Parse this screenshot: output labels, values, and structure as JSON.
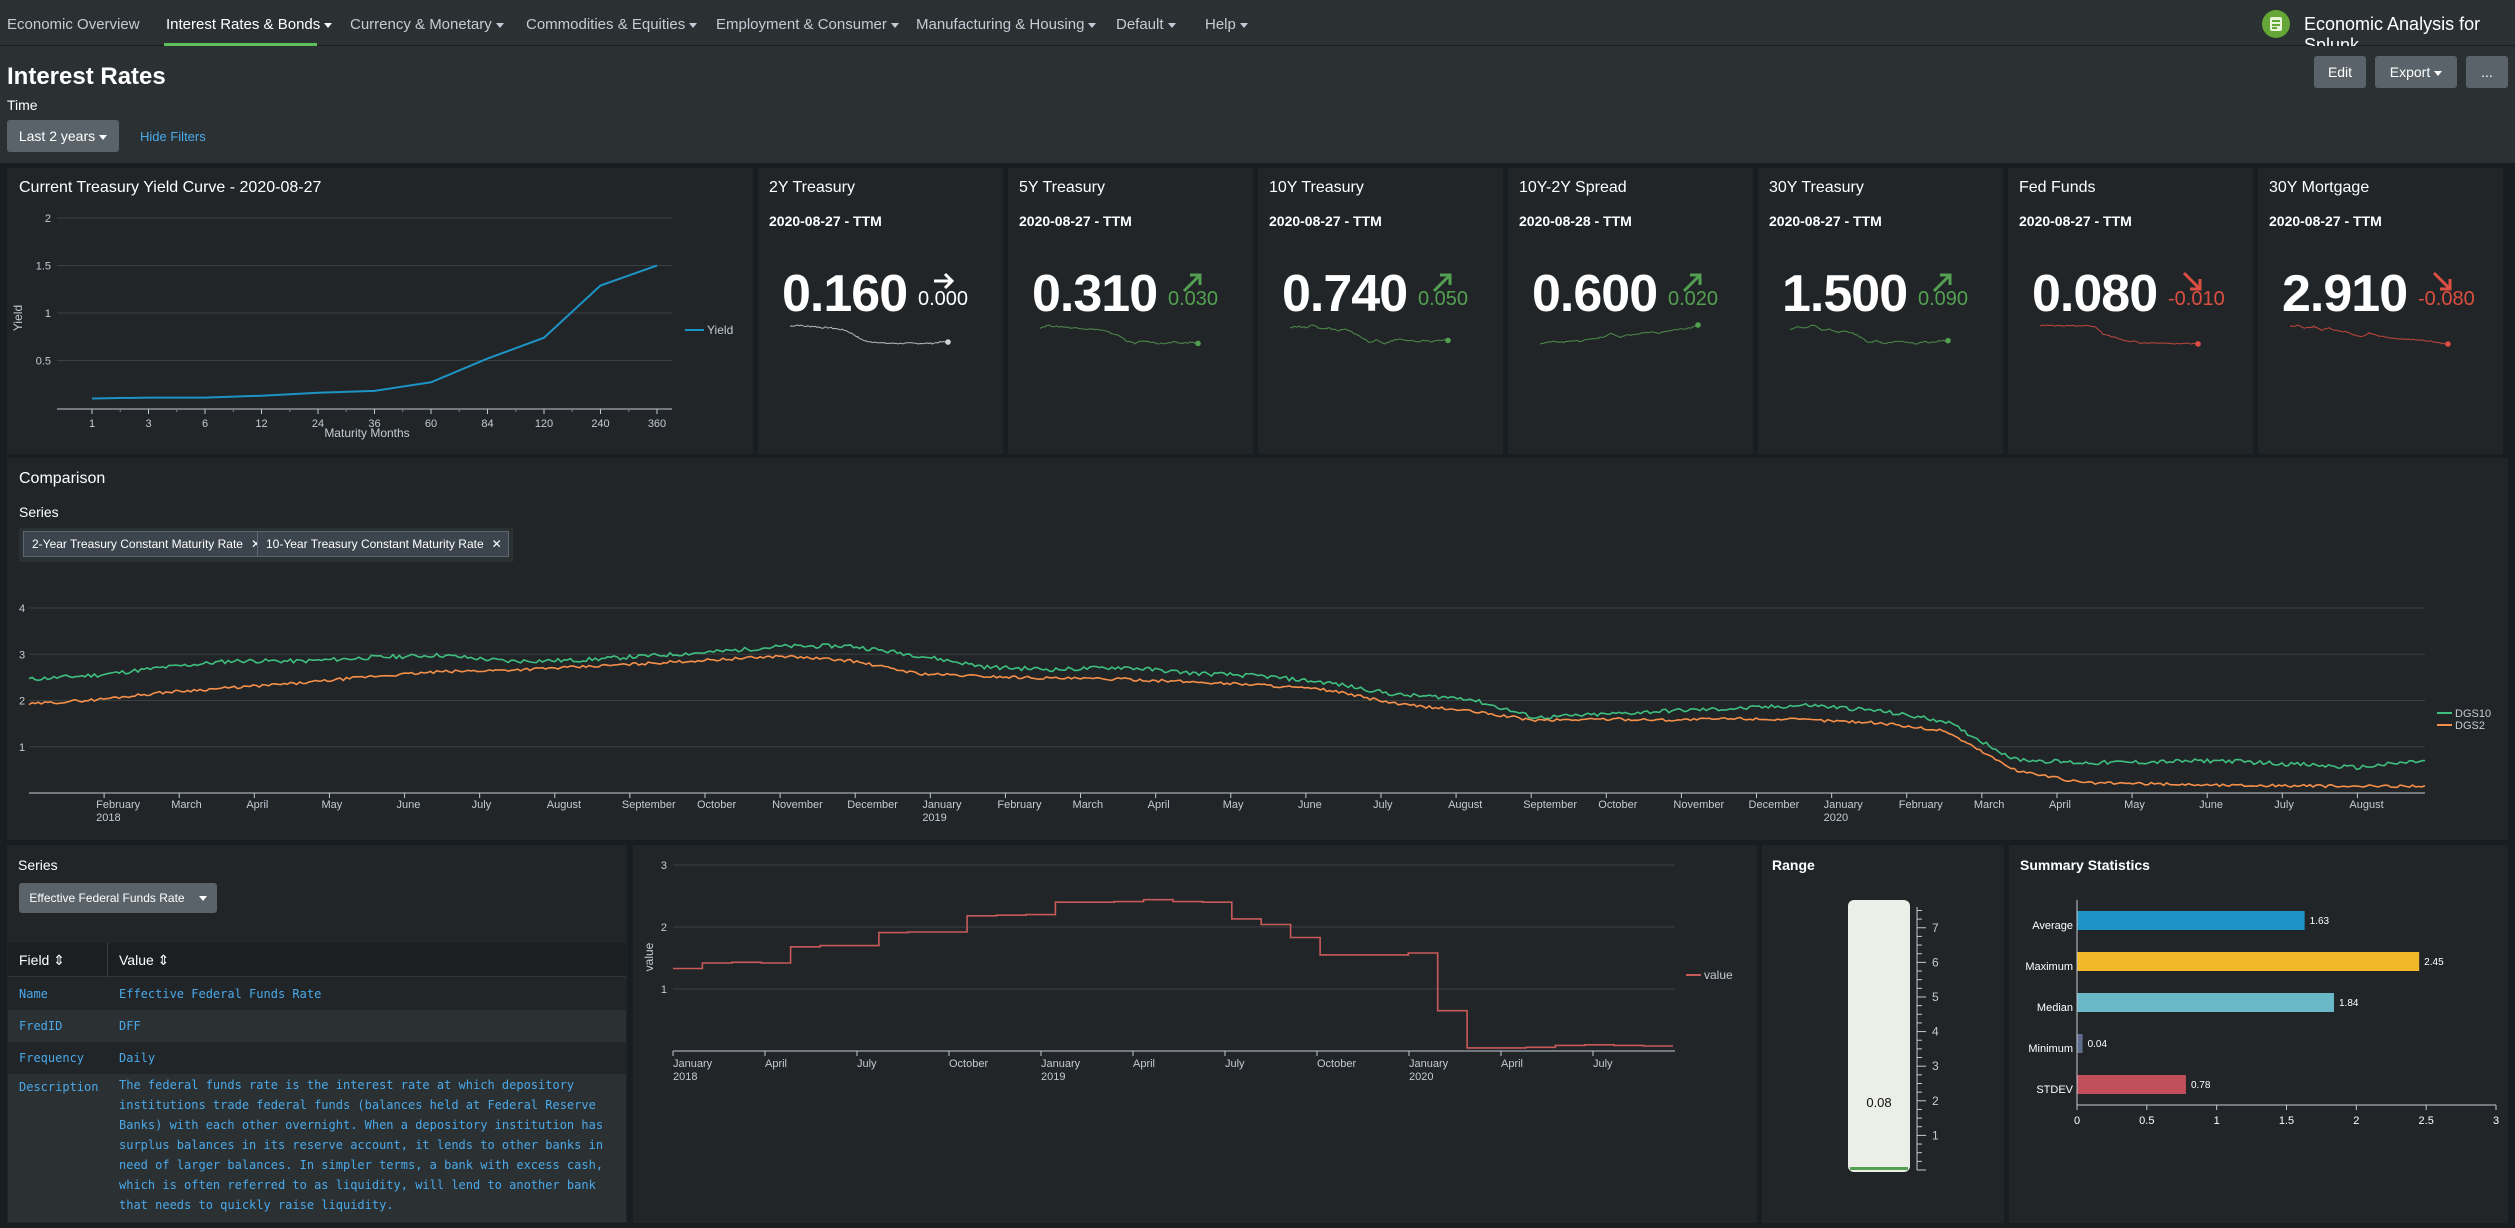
{
  "nav": {
    "items": [
      {
        "label": "Economic Overview",
        "dropdown": false
      },
      {
        "label": "Interest Rates & Bonds",
        "dropdown": true
      },
      {
        "label": "Currency & Monetary",
        "dropdown": true
      },
      {
        "label": "Commodities & Equities",
        "dropdown": true
      },
      {
        "label": "Employment & Consumer",
        "dropdown": true
      },
      {
        "label": "Manufacturing & Housing",
        "dropdown": true
      },
      {
        "label": "Default",
        "dropdown": true
      },
      {
        "label": "Help",
        "dropdown": true
      }
    ],
    "active_index": 1,
    "app_title": "Economic Analysis for Splunk",
    "app_icon": "splunk-app-icon"
  },
  "header": {
    "title": "Interest Rates",
    "time_label": "Time",
    "time_value": "Last 2 years",
    "hide_filters": "Hide Filters",
    "edit": "Edit",
    "export": "Export",
    "more": "..."
  },
  "colors": {
    "up": "#53a051",
    "down": "#dc4e41",
    "neutral": "#ffffff",
    "accent_nav": "#5cc05c",
    "yield_line": "#1e93c6",
    "dgs10": "#3fbf7f",
    "dgs2": "#f58f4a",
    "fedfunds_line": "#c85a5a"
  },
  "yield_curve": {
    "title": "Current Treasury Yield Curve - 2020-08-27",
    "chart_data": {
      "type": "line",
      "categories": [
        "1",
        "3",
        "6",
        "12",
        "24",
        "36",
        "60",
        "84",
        "120",
        "240",
        "360"
      ],
      "series": [
        {
          "name": "Yield",
          "values": [
            0.1,
            0.11,
            0.11,
            0.13,
            0.16,
            0.18,
            0.27,
            0.52,
            0.74,
            1.29,
            1.5
          ]
        }
      ],
      "xlabel": "Maturity Months",
      "ylabel": "Yield",
      "yticks": [
        "0.5",
        "1",
        "1.5",
        "2"
      ],
      "ylim": [
        0,
        2
      ],
      "legend": "right"
    }
  },
  "kpis": [
    {
      "title": "2Y Treasury",
      "subtitle": "2020-08-27 - TTM",
      "value": "0.160",
      "delta": "0.000",
      "trend": "flat",
      "color": "#ffffff",
      "spark": [
        0.28,
        0.29,
        0.28,
        0.28,
        0.27,
        0.27,
        0.26,
        0.25,
        0.22,
        0.18,
        0.16,
        0.16,
        0.15,
        0.15,
        0.15,
        0.15,
        0.15,
        0.15,
        0.15,
        0.16,
        0.16
      ]
    },
    {
      "title": "5Y Treasury",
      "subtitle": "2020-08-27 - TTM",
      "value": "0.310",
      "delta": "0.030",
      "trend": "up",
      "color": "#53a051",
      "spark": [
        0.4,
        0.42,
        0.41,
        0.41,
        0.4,
        0.4,
        0.39,
        0.39,
        0.38,
        0.36,
        0.34,
        0.3,
        0.28,
        0.3,
        0.29,
        0.28,
        0.28,
        0.29,
        0.28,
        0.29,
        0.28
      ]
    },
    {
      "title": "10Y Treasury",
      "subtitle": "2020-08-27 - TTM",
      "value": "0.740",
      "delta": "0.050",
      "trend": "up",
      "color": "#53a051",
      "spark": [
        0.78,
        0.79,
        0.78,
        0.8,
        0.77,
        0.78,
        0.76,
        0.77,
        0.75,
        0.72,
        0.69,
        0.7,
        0.68,
        0.7,
        0.71,
        0.7,
        0.69,
        0.7,
        0.69,
        0.7,
        0.7
      ]
    },
    {
      "title": "10Y-2Y Spread",
      "subtitle": "2020-08-28 - TTM",
      "value": "0.600",
      "delta": "0.020",
      "trend": "up",
      "color": "#53a051",
      "spark": [
        0.42,
        0.43,
        0.44,
        0.43,
        0.45,
        0.44,
        0.46,
        0.47,
        0.48,
        0.52,
        0.48,
        0.5,
        0.51,
        0.52,
        0.53,
        0.52,
        0.54,
        0.55,
        0.56,
        0.57,
        0.6
      ]
    },
    {
      "title": "30Y Treasury",
      "subtitle": "2020-08-27 - TTM",
      "value": "1.500",
      "delta": "0.090",
      "trend": "up",
      "color": "#53a051",
      "spark": [
        1.58,
        1.6,
        1.59,
        1.62,
        1.57,
        1.58,
        1.55,
        1.56,
        1.54,
        1.5,
        1.45,
        1.47,
        1.44,
        1.46,
        1.47,
        1.45,
        1.44,
        1.46,
        1.45,
        1.47,
        1.47
      ]
    },
    {
      "title": "Fed Funds",
      "subtitle": "2020-08-27 - TTM",
      "value": "0.080",
      "delta": "-0.010",
      "trend": "down",
      "color": "#dc4e41",
      "spark": [
        1.55,
        1.56,
        1.55,
        1.54,
        1.55,
        1.55,
        1.56,
        1.5,
        1.2,
        1.1,
        1.0,
        0.9,
        0.9,
        0.8,
        0.82,
        0.8,
        0.81,
        0.8,
        0.8,
        0.8,
        0.78
      ]
    },
    {
      "title": "30Y Mortgage",
      "subtitle": "2020-08-27 - TTM",
      "value": "2.910",
      "delta": "-0.080",
      "trend": "down",
      "color": "#dc4e41",
      "spark": [
        3.1,
        3.12,
        3.08,
        3.1,
        3.06,
        3.08,
        3.05,
        3.04,
        3.0,
        2.98,
        3.02,
        2.99,
        2.97,
        2.96,
        2.95,
        2.95,
        2.94,
        2.93,
        2.92,
        2.9,
        2.89
      ]
    }
  ],
  "comparison": {
    "title": "Comparison",
    "series_label": "Series",
    "chips": [
      "2-Year Treasury Constant Maturity Rate",
      "10-Year Treasury Constant Maturity Rate"
    ],
    "chart_data": {
      "type": "line",
      "x_start": "2018-01",
      "x_end": "2020-08-28",
      "x_labels": [
        "February 2018",
        "March",
        "April",
        "May",
        "June",
        "July",
        "August",
        "September",
        "October",
        "November",
        "December",
        "January 2019",
        "February",
        "March",
        "April",
        "May",
        "June",
        "July",
        "August",
        "September",
        "October",
        "November",
        "December",
        "January 2020",
        "February",
        "March",
        "April",
        "May",
        "June",
        "July",
        "August"
      ],
      "ylim": [
        0,
        4
      ],
      "yticks": [
        "1",
        "2",
        "3",
        "4"
      ],
      "legend": "right",
      "series": [
        {
          "name": "DGS10",
          "values": [
            2.46,
            2.55,
            2.72,
            2.86,
            2.85,
            2.93,
            2.98,
            2.85,
            2.87,
            2.96,
            3.05,
            3.17,
            3.18,
            2.97,
            2.72,
            2.67,
            2.72,
            2.59,
            2.53,
            2.38,
            2.12,
            2.05,
            1.63,
            1.7,
            1.78,
            1.83,
            1.9,
            1.78,
            1.55,
            0.73,
            0.65,
            0.67,
            0.7,
            0.63,
            0.55,
            0.7
          ]
        },
        {
          "name": "DGS2",
          "values": [
            1.92,
            2.02,
            2.18,
            2.28,
            2.38,
            2.52,
            2.62,
            2.66,
            2.72,
            2.8,
            2.88,
            2.96,
            2.86,
            2.58,
            2.52,
            2.48,
            2.46,
            2.4,
            2.34,
            2.22,
            1.92,
            1.78,
            1.57,
            1.6,
            1.58,
            1.61,
            1.58,
            1.52,
            1.34,
            0.5,
            0.22,
            0.2,
            0.17,
            0.16,
            0.14,
            0.16
          ]
        }
      ]
    }
  },
  "details": {
    "series_label": "Series",
    "select_value": "Effective Federal Funds Rate",
    "headers": [
      "Field",
      "Value"
    ],
    "rows": [
      {
        "field": "Name",
        "value": "Effective Federal Funds Rate"
      },
      {
        "field": "FredID",
        "value": "DFF"
      },
      {
        "field": "Frequency",
        "value": "Daily"
      },
      {
        "field": "Description",
        "value": "The federal funds rate is the interest rate at which depository\ninstitutions trade federal funds (balances held at Federal Reserve\nBanks) with each other overnight. When a depository institution has\nsurplus balances in its reserve account, it lends to other banks in\nneed of larger balances. In simpler terms, a bank with excess cash,\nwhich is often referred to as liquidity, will lend to another bank\nthat needs to quickly raise liquidity."
      }
    ]
  },
  "fedfunds": {
    "chart_data": {
      "type": "line",
      "x_start": "2018-01",
      "x_end": "2020-08-28",
      "x_labels": [
        "January 2018",
        "April",
        "July",
        "October",
        "January 2019",
        "April",
        "July",
        "October",
        "January 2020",
        "April",
        "July"
      ],
      "ylabel": "value",
      "ylim": [
        0,
        3
      ],
      "yticks": [
        "1",
        "2",
        "3"
      ],
      "legend": "right",
      "series": [
        {
          "name": "value",
          "values": [
            1.33,
            1.42,
            1.43,
            1.42,
            1.68,
            1.7,
            1.7,
            1.91,
            1.92,
            1.92,
            2.18,
            2.19,
            2.2,
            2.4,
            2.4,
            2.41,
            2.44,
            2.41,
            2.4,
            2.13,
            2.04,
            1.83,
            1.55,
            1.55,
            1.55,
            1.58,
            0.65,
            0.05,
            0.05,
            0.06,
            0.09,
            0.1,
            0.09,
            0.08
          ]
        }
      ]
    }
  },
  "range": {
    "title": "Range",
    "chart_data": {
      "type": "gauge",
      "value": 0.08,
      "label": "0.08",
      "ticks": [
        "1",
        "2",
        "3",
        "4",
        "5",
        "6",
        "7"
      ],
      "min": 0,
      "max": 7.6
    }
  },
  "summary": {
    "title": "Summary Statistics",
    "chart_data": {
      "type": "bar",
      "orientation": "horizontal",
      "categories": [
        "Average",
        "Maximum",
        "Median",
        "Minimum",
        "STDEV"
      ],
      "values": [
        1.63,
        2.45,
        1.84,
        0.04,
        0.78
      ],
      "value_labels": [
        "1.63",
        "2.45",
        "1.84",
        "0.04",
        "0.78"
      ],
      "bar_colors": [
        "#1e93c6",
        "#f2b827",
        "#6ab7c7",
        "#5f6b8a",
        "#c14f5b"
      ],
      "xlim": [
        0,
        3
      ],
      "xticks": [
        "0",
        "0.5",
        "1",
        "1.5",
        "2",
        "2.5",
        "3"
      ]
    }
  }
}
